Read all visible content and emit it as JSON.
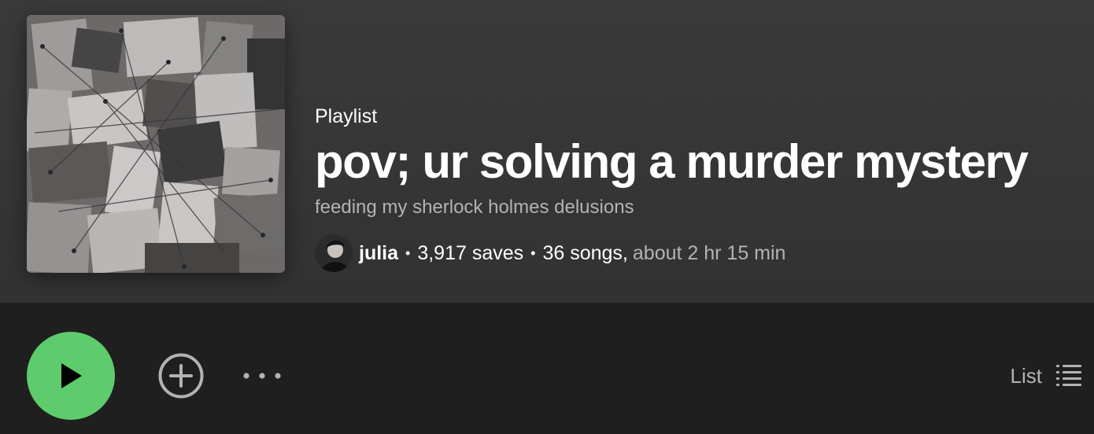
{
  "playlist": {
    "kind_label": "Playlist",
    "title": "pov; ur solving a murder mystery",
    "description": "feeding my sherlock holmes delusions",
    "owner": "julia",
    "separator": "•",
    "saves": "3,917 saves",
    "songs": "36 songs,",
    "duration": "about 2 hr 15 min"
  },
  "controls": {
    "view_label": "List"
  },
  "colors": {
    "accent_green": "#5ecc6c",
    "header_bg": "#3a3a3a",
    "page_bg": "#1f1f1f",
    "subdued_text": "#b3b3b3"
  },
  "icons": {
    "play": "play-icon",
    "add": "add-circle-icon",
    "more": "more-horizontal-icon",
    "list": "list-view-icon"
  }
}
